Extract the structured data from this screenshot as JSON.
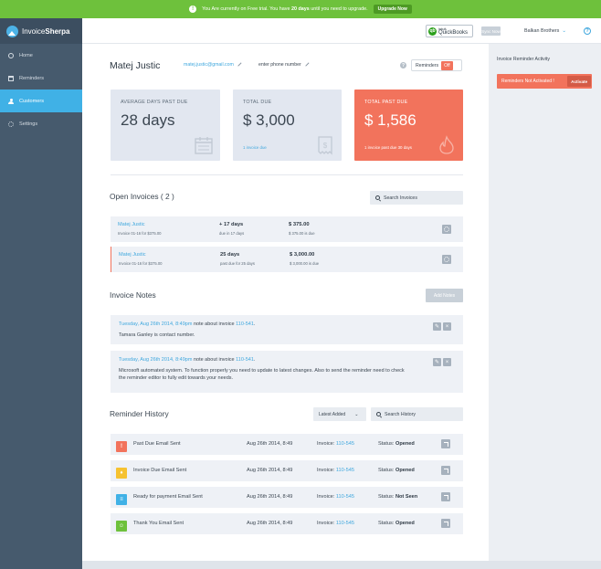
{
  "banner": {
    "pre": "You Are currently on Free trial. You have ",
    "days": "20 days",
    "post": " until you need to upgrade.",
    "upgrade_label": "Upgrade Now"
  },
  "app": {
    "logo_light": "Invoice",
    "logo_bold": "Sherpa"
  },
  "sidebar": {
    "items": [
      {
        "label": "Home",
        "icon": "home-icon"
      },
      {
        "label": "Reminders",
        "icon": "reminders-icon"
      },
      {
        "label": "Customers",
        "icon": "customers-icon",
        "active": true
      },
      {
        "label": "Settings",
        "icon": "settings-icon"
      }
    ]
  },
  "header": {
    "qb_small": "intuit",
    "qb_name": "QuickBooks",
    "sync_label": "Sync Now",
    "account": "Balkan Brothers",
    "help": "?"
  },
  "customer": {
    "name": "Matej Justic",
    "email": "matej.justic@gmail.com",
    "phone_placeholder": "enter phone number",
    "reminders_label": "Reminders",
    "reminders_state": "Off"
  },
  "stats": [
    {
      "label": "Average days past due",
      "value": "28 days",
      "sub": ""
    },
    {
      "label": "Total due",
      "value": "$ 3,000",
      "sub": "1 invoice due"
    },
    {
      "label": "Total past due",
      "value": "$ 1,586",
      "sub": "1 invoice past due 30 days"
    }
  ],
  "open_invoices": {
    "title": "Open Invoices ( 2 )",
    "search_placeholder": "Search Invoices",
    "rows": [
      {
        "name": "Matej Justic",
        "sub": "Invoice 01-16 for $375.00",
        "days": "+ 17 days",
        "days_sub": "due in 17 days",
        "amount": "$ 375.00",
        "amount_sub": "$ 375.00 is due",
        "past_due": false
      },
      {
        "name": "Matej Justic",
        "sub": "Invoice 01-16 for $375.00",
        "days": "25 days",
        "days_sub": "past due for 25 days",
        "amount": "$ 3,000.00",
        "amount_sub": "$ 3,000.00 is due",
        "past_due": true
      }
    ]
  },
  "notes": {
    "title": "Invoice Notes",
    "add_label": "Add Notes",
    "items": [
      {
        "date": "Tuesday, Aug 26th 2014, 8:49pm",
        "mid": " note about invoice ",
        "invoice": "110-541",
        "tail": ".",
        "body": "Tamara Ganley is contact number."
      },
      {
        "date": "Tuesday, Aug 26th 2014, 8:49pm",
        "mid": " note about invoice ",
        "invoice": "110-541",
        "tail": ".",
        "body": "Microsoft automated system. To function properly you need to update to latest changes. Also to send the reminder need to check the reminder editor to fully edit towards your needs."
      }
    ]
  },
  "history": {
    "title": "Reminder History",
    "sort_label": "Latest Added",
    "search_placeholder": "Search History",
    "rows": [
      {
        "label": "Past Due Email Sent",
        "date": "Aug 26th 2014, 8:49",
        "invoice_prefix": "Invoice: ",
        "invoice": "110-545",
        "status_prefix": "Status: ",
        "status": "Opened",
        "color": "#f2735c",
        "icon": "warning-icon"
      },
      {
        "label": "Invoice Due Email Sent",
        "date": "Aug 26th 2014, 8:49",
        "invoice_prefix": "Invoice: ",
        "invoice": "110-545",
        "status_prefix": "Status: ",
        "status": "Opened",
        "color": "#f6c230",
        "icon": "bell-icon"
      },
      {
        "label": "Ready for payment Email Sent",
        "date": "Aug 26th 2014, 8:49",
        "invoice_prefix": "Invoice: ",
        "invoice": "110-545",
        "status_prefix": "Status: ",
        "status": "Not Seen",
        "color": "#40b1e6",
        "icon": "document-icon"
      },
      {
        "label": "Thank You Email Sent",
        "date": "Aug 26th 2014, 8:49",
        "invoice_prefix": "Invoice: ",
        "invoice": "110-545",
        "status_prefix": "Status: ",
        "status": "Opened",
        "color": "#6ec13c",
        "icon": "smile-icon"
      }
    ]
  },
  "right_panel": {
    "title": "Invoice Reminder Activity",
    "message": "Reminders Not Activated !",
    "activate_label": "Activate"
  }
}
